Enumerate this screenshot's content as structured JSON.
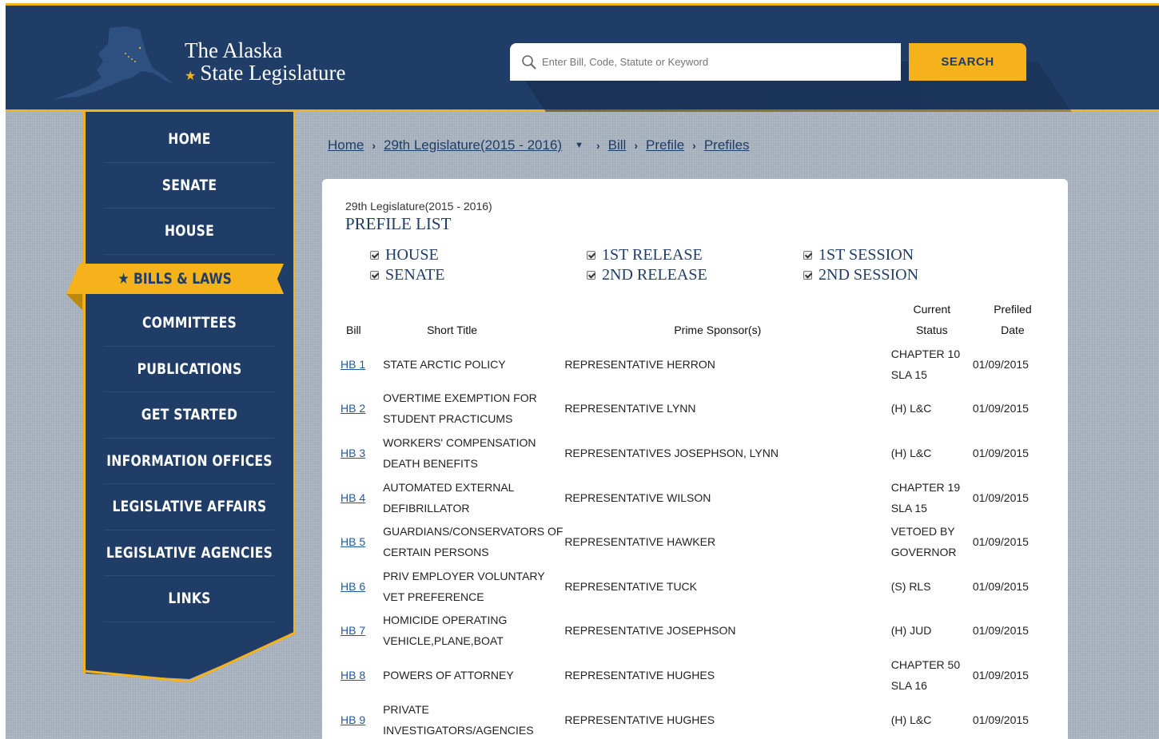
{
  "header": {
    "logo_line1": "The Alaska",
    "logo_line2": "State Legislature",
    "search_placeholder": "Enter Bill, Code, Statute or Keyword",
    "search_button": "SEARCH"
  },
  "nav": {
    "items": [
      {
        "label": "HOME"
      },
      {
        "label": "SENATE"
      },
      {
        "label": "HOUSE"
      },
      {
        "label": "★ BILLS & LAWS",
        "active": true
      },
      {
        "label": "COMMITTEES"
      },
      {
        "label": "PUBLICATIONS"
      },
      {
        "label": "GET STARTED"
      },
      {
        "label": "INFORMATION OFFICES"
      },
      {
        "label": "LEGISLATIVE AFFAIRS"
      },
      {
        "label": "LEGISLATIVE AGENCIES"
      },
      {
        "label": "LINKS"
      }
    ]
  },
  "breadcrumb": {
    "home": "Home",
    "legislature": "29th Legislature(2015 - 2016)",
    "bill": "Bill",
    "prefile": "Prefile",
    "prefiles": "Prefiles"
  },
  "panel": {
    "subtitle": "29th Legislature(2015 - 2016)",
    "title": "PREFILE LIST",
    "filters": {
      "house": "HOUSE",
      "senate": "SENATE",
      "release1": "1ST RELEASE",
      "release2": "2ND RELEASE",
      "session1": "1ST SESSION",
      "session2": "2ND SESSION"
    }
  },
  "table": {
    "headers": {
      "bill": "Bill",
      "title": "Short Title",
      "sponsor": "Prime Sponsor(s)",
      "status_1": "Current",
      "status_2": "Status",
      "date_1": "Prefiled",
      "date_2": "Date"
    },
    "rows": [
      {
        "bill": "HB 1",
        "title": "STATE ARCTIC POLICY",
        "sponsor": "REPRESENTATIVE HERRON",
        "status": "CHAPTER 10 SLA 15",
        "date": "01/09/2015"
      },
      {
        "bill": "HB 2",
        "title": "OVERTIME EXEMPTION FOR STUDENT PRACTICUMS",
        "sponsor": "REPRESENTATIVE LYNN",
        "status": "(H) L&C",
        "date": "01/09/2015"
      },
      {
        "bill": "HB 3",
        "title": "WORKERS' COMPENSATION DEATH BENEFITS",
        "sponsor": "REPRESENTATIVES JOSEPHSON, LYNN",
        "status": "(H) L&C",
        "date": "01/09/2015"
      },
      {
        "bill": "HB 4",
        "title": "AUTOMATED EXTERNAL DEFIBRILLATOR",
        "sponsor": "REPRESENTATIVE WILSON",
        "status": "CHAPTER 19 SLA 15",
        "date": "01/09/2015"
      },
      {
        "bill": "HB 5",
        "title": "GUARDIANS/CONSERVATORS OF CERTAIN PERSONS",
        "sponsor": "REPRESENTATIVE HAWKER",
        "status": "VETOED BY GOVERNOR",
        "date": "01/09/2015"
      },
      {
        "bill": "HB 6",
        "title": "PRIV EMPLOYER VOLUNTARY VET PREFERENCE",
        "sponsor": "REPRESENTATIVE TUCK",
        "status": "(S) RLS",
        "date": "01/09/2015"
      },
      {
        "bill": "HB 7",
        "title": "HOMICIDE OPERATING VEHICLE,PLANE,BOAT",
        "sponsor": "REPRESENTATIVE JOSEPHSON",
        "status": "(H) JUD",
        "date": "01/09/2015"
      },
      {
        "bill": "HB 8",
        "title": "POWERS OF ATTORNEY",
        "sponsor": "REPRESENTATIVE HUGHES",
        "status": "CHAPTER 50 SLA 16",
        "date": "01/09/2015"
      },
      {
        "bill": "HB 9",
        "title": "PRIVATE INVESTIGATORS/AGENCIES",
        "sponsor": "REPRESENTATIVE HUGHES",
        "status": "(H) L&C",
        "date": "01/09/2015"
      }
    ]
  },
  "colors": {
    "navy": "#1f3d66",
    "gold": "#f5b21a",
    "link": "#1f5a9c",
    "background": "#a9b4c0"
  }
}
